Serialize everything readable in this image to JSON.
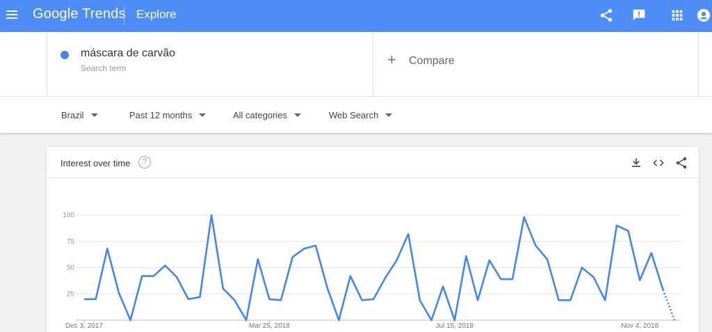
{
  "header": {
    "logo_google": "Google",
    "logo_trends": "Trends",
    "section_title": "Explore",
    "icons": [
      "menu-icon",
      "share-icon",
      "feedback-icon",
      "apps-icon",
      "account-icon"
    ]
  },
  "search": {
    "term": "máscara de carvão",
    "term_type": "Search term",
    "term_color": "#4285f4",
    "compare_plus": "+",
    "compare_label": "Compare"
  },
  "filters": {
    "region": "Brazil",
    "time_range": "Past 12 months",
    "category": "All categories",
    "property": "Web Search"
  },
  "card": {
    "title": "Interest over time",
    "help_glyph": "?",
    "icons": [
      "download-icon",
      "embed-icon",
      "share-icon"
    ]
  },
  "chart_data": {
    "type": "line",
    "title": "Interest over time",
    "series": [
      {
        "name": "máscara de carvão",
        "color": "#4285f4",
        "values": [
          20,
          20,
          68,
          26,
          0,
          42,
          42,
          52,
          41,
          20,
          22,
          100,
          30,
          19,
          0,
          58,
          20,
          19,
          60,
          68,
          71,
          31,
          0,
          42,
          19,
          20,
          40,
          57,
          82,
          19,
          0,
          32,
          0,
          61,
          19,
          57,
          39,
          39,
          98,
          71,
          58,
          19,
          19,
          50,
          41,
          19,
          90,
          85,
          38,
          64,
          29,
          0
        ],
        "partial_from_index": 50
      }
    ],
    "x_tick_labels": [
      "Dec 3, 2017",
      "Mar 25, 2018",
      "Jul 15, 2018",
      "Nov 4, 2018"
    ],
    "x_tick_indices": [
      0,
      16,
      32,
      48
    ],
    "y_ticks": [
      25,
      50,
      75,
      100
    ],
    "ylim": [
      0,
      100
    ],
    "grid": true
  }
}
